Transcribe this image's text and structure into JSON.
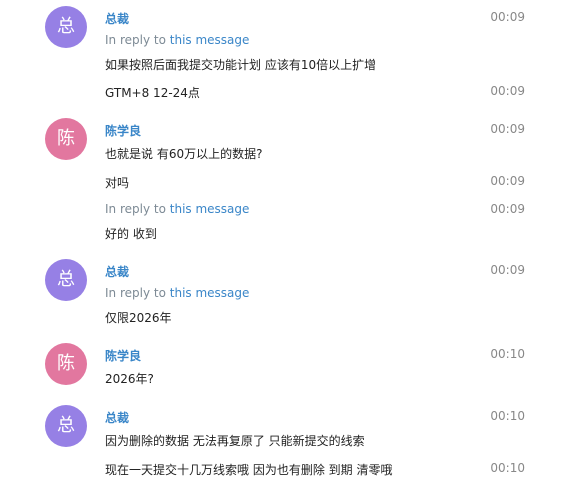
{
  "colors": {
    "purple_avatar": "#9680e5",
    "pink_avatar": "#e2779f",
    "sender": "#3a86c8",
    "link": "#3a86c8"
  },
  "reply_prefix": "In reply to",
  "reply_link": "this message",
  "groups": [
    {
      "avatar": "总",
      "sender": "总裁",
      "time": "00:09",
      "reply": true,
      "text": "如果按照后面我提交功能计划 应该有10倍以上扩增",
      "followups": [
        {
          "text": "GTM+8 12-24点",
          "time": "00:09"
        }
      ]
    },
    {
      "avatar": "陈",
      "sender": "陈学良",
      "time": "00:09",
      "reply": false,
      "text": "也就是说 有60万以上的数据?",
      "followups": [
        {
          "text": "对吗",
          "time": "00:09"
        },
        {
          "reply": true,
          "text": "好的 收到",
          "time": "00:09"
        }
      ]
    },
    {
      "avatar": "总",
      "sender": "总裁",
      "time": "00:09",
      "reply": true,
      "text": "仅限2026年"
    },
    {
      "avatar": "陈",
      "sender": "陈学良",
      "time": "00:10",
      "reply": false,
      "text": "2026年?"
    },
    {
      "avatar": "总",
      "sender": "总裁",
      "time": "00:10",
      "reply": false,
      "text": "因为删除的数据 无法再复原了 只能新提交的线索",
      "followups": [
        {
          "text": "现在一天提交十几万线索哦 因为也有删除 到期 清零哦",
          "time": "00:10"
        }
      ]
    }
  ]
}
